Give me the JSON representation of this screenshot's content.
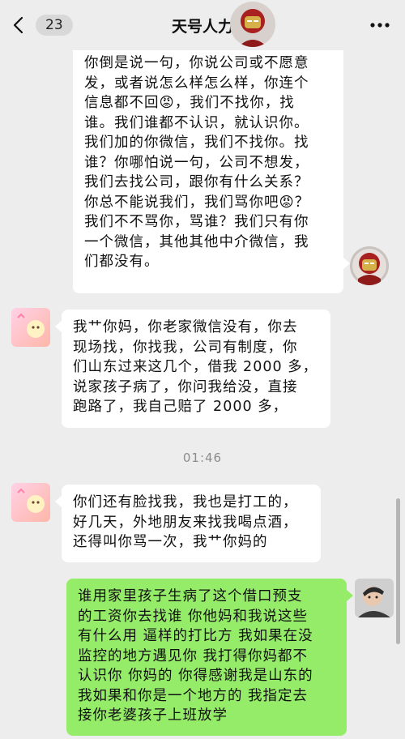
{
  "header": {
    "unread_count": "23",
    "title": "天号人力",
    "more_label": "···"
  },
  "messages": [
    {
      "id": "m1",
      "side": "right",
      "text": "你倒是说一句，你说公司或不愿意\n发，或者说怎么样怎么样，你连个\n信息都不回😡，我们不找你，找\n谁。我们谁都不认识，就认识你。\n我们加的你微信，我们不找你。找\n谁？你哪怕说一句，公司不想发，\n我们去找公司，跟你有什么关系？\n你总不能说我们，我们骂你吧😡？\n我们不不骂你，骂谁？我们只有你\n一个微信，其他其他中介微信，我\n们都没有。"
    },
    {
      "id": "m2",
      "side": "left",
      "text": "我艹你妈，你老家微信没有，你去\n现场找，你找我，公司有制度，你\n们山东过来这几个，借我 2000 多，\n说家孩子病了，你问我给没，直接\n跑路了，我自己赔了 2000 多，"
    },
    {
      "id": "m3",
      "side": "left",
      "text": "你们还有脸找我，我也是打工的，\n好几天，外地朋友来找我喝点酒，\n还得叫你骂一次，我艹你妈的"
    },
    {
      "id": "m4",
      "side": "right",
      "text": "谁用家里孩子生病了这个借口预支\n的工资你去找谁 你他妈和我说这些\n有什么用 逼样的打比方 我如果在没\n监控的地方遇见你 我打得你妈都不\n认识你 你妈的 你得感谢我是山东的\n我如果和你是一个地方的 我指定去\n接你老婆孩子上班放学"
    }
  ],
  "timestamp": "01:46",
  "colors": {
    "background": "#ededed",
    "bubble_self": "#95ec69",
    "bubble_other": "#ffffff",
    "timestamp": "#8c8c8c"
  },
  "icons": {
    "back": "chevron-left-icon",
    "more": "more-dots-icon"
  }
}
